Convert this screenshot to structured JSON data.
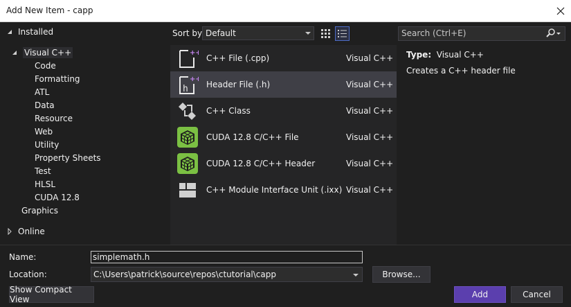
{
  "window": {
    "title": "Add New Item - capp"
  },
  "tree": {
    "installed_label": "Installed",
    "visual_cpp_label": "Visual C++",
    "children": [
      "Code",
      "Formatting",
      "ATL",
      "Data",
      "Resource",
      "Web",
      "Utility",
      "Property Sheets",
      "Test",
      "HLSL",
      "CUDA 12.8"
    ],
    "graphics_label": "Graphics",
    "online_label": "Online"
  },
  "toolbar": {
    "sort_label": "Sort by:",
    "sort_value": "Default",
    "search_placeholder": "Search (Ctrl+E)"
  },
  "templates": [
    {
      "name": "C++ File (.cpp)",
      "language": "Visual C++",
      "icon": "cpp-file-icon"
    },
    {
      "name": "Header File (.h)",
      "language": "Visual C++",
      "icon": "header-file-icon"
    },
    {
      "name": "C++ Class",
      "language": "Visual C++",
      "icon": "cpp-class-icon"
    },
    {
      "name": "CUDA 12.8 C/C++ File",
      "language": "Visual C++",
      "icon": "cuda-cube-icon"
    },
    {
      "name": "CUDA 12.8 C/C++ Header",
      "language": "Visual C++",
      "icon": "cuda-cube-icon"
    },
    {
      "name": "C++ Module Interface Unit (.ixx)",
      "language": "Visual C++",
      "icon": "module-interface-icon"
    }
  ],
  "details": {
    "type_label": "Type:",
    "type_value": "Visual C++",
    "description": "Creates a C++ header file"
  },
  "form": {
    "name_label": "Name:",
    "name_value": "simplemath.h",
    "location_label": "Location:",
    "location_value": "C:\\Users\\patrick\\source\\repos\\ctutorial\\capp",
    "browse_label": "Browse...",
    "compact_label": "Show Compact View",
    "add_label": "Add",
    "cancel_label": "Cancel"
  },
  "colors": {
    "accent": "#5b3fae",
    "background": "#1f1f1f",
    "list_bg": "#252526",
    "selected_row": "#3f3f46"
  }
}
